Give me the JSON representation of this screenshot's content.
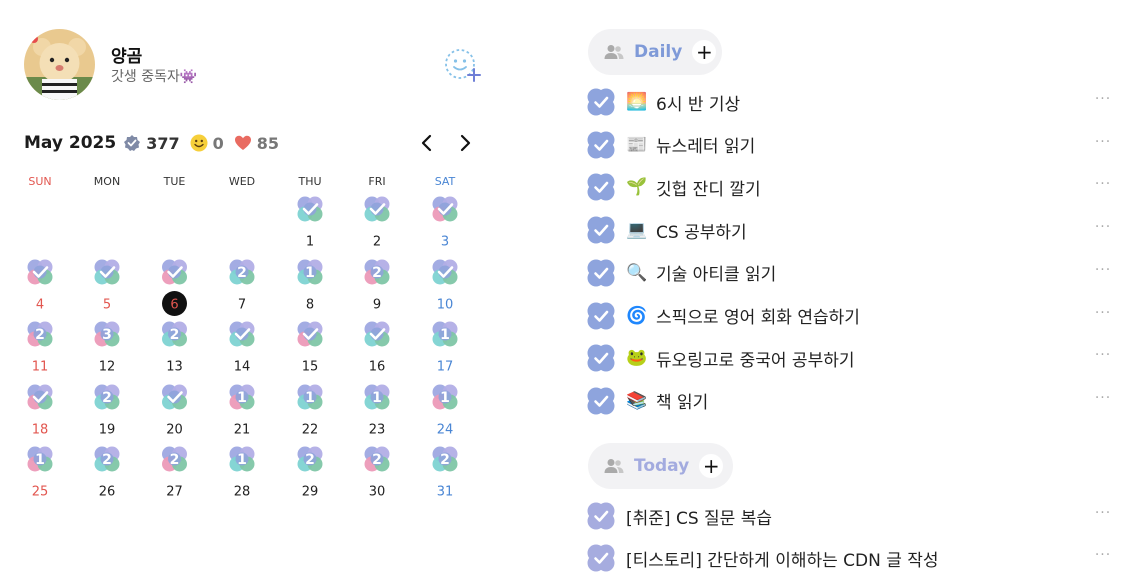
{
  "profile": {
    "name": "양곰",
    "bio": "갓생 중독자👾"
  },
  "stats": {
    "month": "May 2025",
    "checks": "377",
    "smiles": "0",
    "hearts": "85"
  },
  "calendar": {
    "weekdays": [
      "SUN",
      "MON",
      "TUE",
      "WED",
      "THU",
      "FRI",
      "SAT"
    ],
    "weekday_colors": [
      "#e2564f",
      "#333333",
      "#333333",
      "#333333",
      "#333333",
      "#333333",
      "#4a86d4"
    ],
    "selected_day": 6,
    "holidays": [
      5,
      6
    ],
    "days": [
      {
        "day": 1,
        "mark": "check"
      },
      {
        "day": 2,
        "mark": "check"
      },
      {
        "day": 3,
        "mark": "check"
      },
      {
        "day": 4,
        "mark": "check"
      },
      {
        "day": 5,
        "mark": "check"
      },
      {
        "day": 6,
        "mark": "check"
      },
      {
        "day": 7,
        "mark": "2"
      },
      {
        "day": 8,
        "mark": "1"
      },
      {
        "day": 9,
        "mark": "2"
      },
      {
        "day": 10,
        "mark": "check"
      },
      {
        "day": 11,
        "mark": "2"
      },
      {
        "day": 12,
        "mark": "3"
      },
      {
        "day": 13,
        "mark": "2"
      },
      {
        "day": 14,
        "mark": "check"
      },
      {
        "day": 15,
        "mark": "check"
      },
      {
        "day": 16,
        "mark": "check"
      },
      {
        "day": 17,
        "mark": "1"
      },
      {
        "day": 18,
        "mark": "check"
      },
      {
        "day": 19,
        "mark": "2"
      },
      {
        "day": 20,
        "mark": "check"
      },
      {
        "day": 21,
        "mark": "1"
      },
      {
        "day": 22,
        "mark": "1"
      },
      {
        "day": 23,
        "mark": "1"
      },
      {
        "day": 24,
        "mark": "1"
      },
      {
        "day": 25,
        "mark": "1"
      },
      {
        "day": 26,
        "mark": "2"
      },
      {
        "day": 27,
        "mark": "2"
      },
      {
        "day": 28,
        "mark": "1"
      },
      {
        "day": 29,
        "mark": "2"
      },
      {
        "day": 30,
        "mark": "2"
      },
      {
        "day": 31,
        "mark": "2"
      }
    ],
    "first_weekday": 4
  },
  "sections": {
    "daily": {
      "label": "Daily",
      "color": "#7f9ad8",
      "add_label": "+",
      "items": [
        {
          "emoji": "🌅",
          "text": "6시 반 기상"
        },
        {
          "emoji": "📰",
          "text": "뉴스레터 읽기"
        },
        {
          "emoji": "🌱",
          "text": "깃헙 잔디 깔기"
        },
        {
          "emoji": "💻",
          "text": "CS 공부하기"
        },
        {
          "emoji": "🔍",
          "text": "기술 아티클 읽기"
        },
        {
          "emoji": "🌀",
          "text": "스픽으로 영어 회화 연습하기"
        },
        {
          "emoji": "🐸",
          "text": "듀오링고로 중국어 공부하기"
        },
        {
          "emoji": "📚",
          "text": "책 읽기"
        }
      ]
    },
    "today": {
      "label": "Today",
      "color": "#a3abdf",
      "add_label": "+",
      "items": [
        {
          "emoji": "",
          "text": "[취준] CS 질문 복습"
        },
        {
          "emoji": "",
          "text": "[티스토리] 간단하게 이해하는 CDN 글 작성"
        }
      ]
    }
  },
  "more_label": "···",
  "colors": {
    "check_daily": "#8ea4dd",
    "check_today": "#a6acdf",
    "sunday": "#e2564f",
    "saturday": "#4a86d4"
  }
}
